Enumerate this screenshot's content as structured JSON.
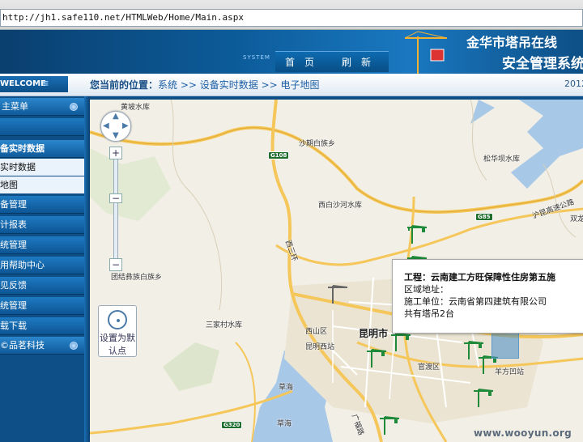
{
  "browser": {
    "url": "http://jh1.safe110.net/HTMLWeb/Home/Main.aspx"
  },
  "header": {
    "system_label": "SYSTEM",
    "nav": [
      "首　页",
      "刷　新"
    ],
    "title_line1": "金华市塔吊在线",
    "title_line2": "安全管理系统"
  },
  "crumbbar": {
    "welcome": "WELCOME",
    "welcome_arrow": "≡",
    "location_label": "您当前的位置：",
    "path": [
      "系统",
      ">> 设备实时数据",
      ">> 电子地图"
    ],
    "date": "2012"
  },
  "sidebar": {
    "items": [
      {
        "label": "主菜单"
      },
      {
        "label": ""
      },
      {
        "label": "备实时数据"
      },
      {
        "label": "实时数据"
      },
      {
        "label": "地图"
      },
      {
        "label": "备管理"
      },
      {
        "label": "计报表"
      },
      {
        "label": "统管理"
      },
      {
        "label": "用帮助中心"
      },
      {
        "label": "见反馈"
      },
      {
        "label": "统管理"
      },
      {
        "label": "载下载"
      },
      {
        "label": "©品茗科技"
      }
    ]
  },
  "map": {
    "labels": {
      "huangpo": "黄坡水库",
      "shadian": "沙期白族乡",
      "xibai": "西白沙河水库",
      "songhua": "松华坝水库",
      "hukun": "沪昆高速公路",
      "shuangshao": "双龙",
      "xisanhuan": "西三环",
      "tuanjie": "团结彝族白族乡",
      "sanjia": "三家村水库",
      "xishan": "西山区",
      "kunming": "昆明市",
      "kunmingxi": "昆明西站",
      "guandu": "官渡区",
      "yangfang": "羊方凹站",
      "caohai1": "草海",
      "caohai2": "草海",
      "g108": "G108",
      "g85": "G85",
      "g320": "G320",
      "huanhu": "广福路"
    },
    "set_default": "设置为默认点",
    "info": {
      "title": "工程：云南建工方旺保障性住房第五施",
      "line1": "区域地址：",
      "line2": "施工单位：云南省第四建筑有限公司",
      "line3": "共有塔吊2台"
    },
    "zoom_in": "+",
    "zoom_out": "−"
  },
  "watermark": "www.wooyun.org",
  "colors": {
    "banner": "#0c5b99",
    "menu": "#1e7ac2",
    "crane": "#1e8a3a",
    "road_main": "#f5c75a",
    "water": "#a8c8e8"
  }
}
